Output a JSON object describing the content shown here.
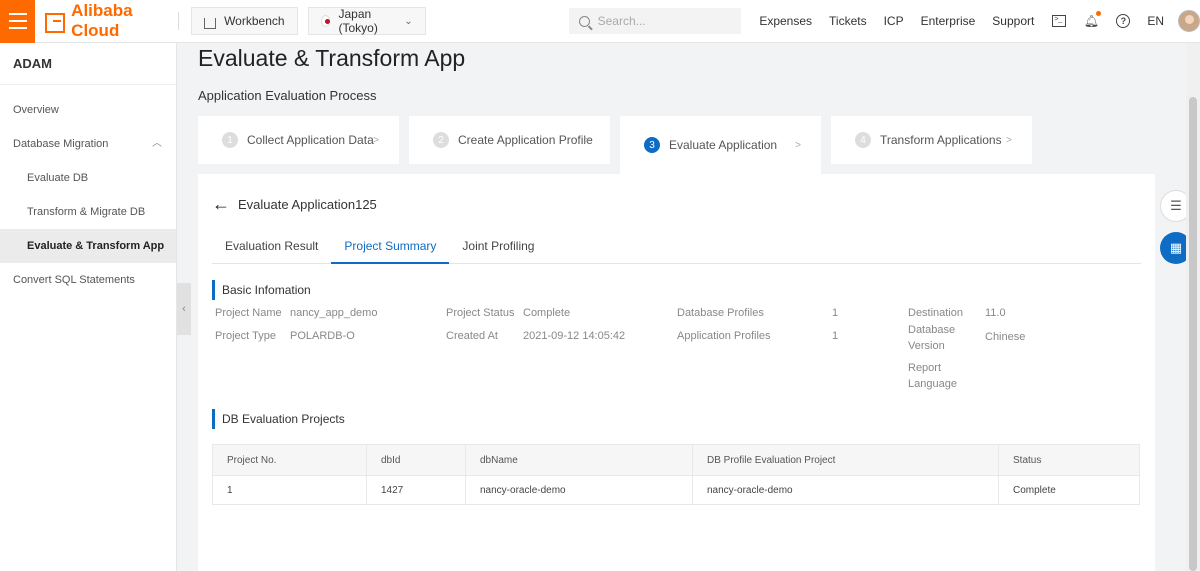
{
  "topbar": {
    "brand": "Alibaba Cloud",
    "workbench": "Workbench",
    "region": "Japan (Tokyo)",
    "search_placeholder": "Search...",
    "links": [
      "Expenses",
      "Tickets",
      "ICP",
      "Enterprise",
      "Support"
    ],
    "lang": "EN",
    "accent": "#ff6a00"
  },
  "sidebar": {
    "title": "ADAM",
    "items": [
      {
        "label": "Overview"
      },
      {
        "label": "Database Migration"
      },
      {
        "label": "Evaluate DB"
      },
      {
        "label": "Transform & Migrate DB"
      },
      {
        "label": "Evaluate & Transform App"
      },
      {
        "label": "Convert SQL Statements"
      }
    ]
  },
  "main": {
    "title": "Evaluate & Transform App",
    "section": "Application Evaluation Process",
    "steps": [
      {
        "num": "1",
        "label": "Collect Application Data"
      },
      {
        "num": "2",
        "label": "Create Application Profile"
      },
      {
        "num": "3",
        "label": "Evaluate Application"
      },
      {
        "num": "4",
        "label": "Transform Applications"
      }
    ],
    "step_arrow": ">",
    "back_title": "Evaluate Application125",
    "tabs": [
      "Evaluation Result",
      "Project Summary",
      "Joint Profiling"
    ],
    "basic_title": "Basic Infomation",
    "info": {
      "project_name_label": "Project Name",
      "project_name": "nancy_app_demo",
      "project_type_label": "Project Type",
      "project_type": "POLARDB-O",
      "project_status_label": "Project Status",
      "project_status": "Complete",
      "created_at_label": "Created At",
      "created_at": "2021-09-12 14:05:42",
      "db_profiles_label": "Database Profiles",
      "db_profiles": "1",
      "app_profiles_label": "Application Profiles",
      "app_profiles": "1",
      "dest_label": "Destination",
      "dest": "11.0",
      "dbver_label_1": "Database",
      "dbver_label_2": "Version",
      "dbver": "Chinese",
      "report_label_1": "Report",
      "report_label_2": "Language"
    },
    "db_eval_title": "DB Evaluation Projects",
    "table": {
      "headers": [
        "Project No.",
        "dbId",
        "dbName",
        "DB Profile Evaluation Project",
        "Status"
      ],
      "rows": [
        [
          "1",
          "1427",
          "nancy-oracle-demo",
          "nancy-oracle-demo",
          "Complete"
        ]
      ]
    }
  },
  "colors": {
    "primary": "#0f6cc4",
    "orange": "#ff6a00"
  }
}
